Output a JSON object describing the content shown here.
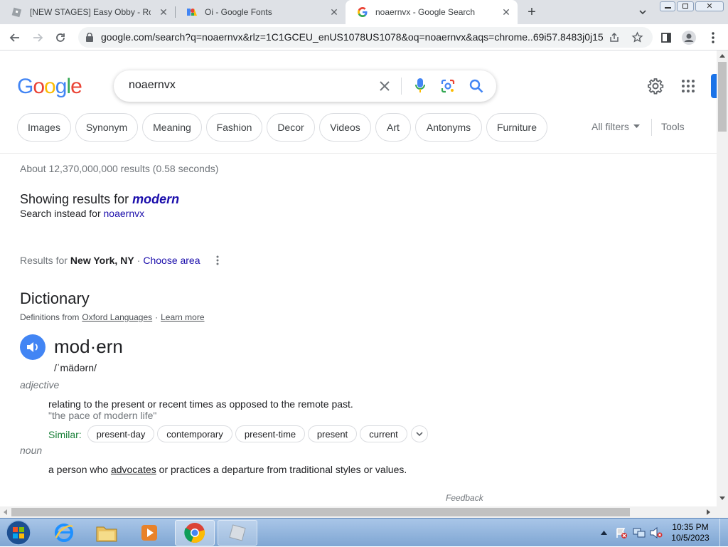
{
  "browser": {
    "tabs": [
      {
        "title": "[NEW STAGES] Easy Obby - Roblox",
        "close": "✕"
      },
      {
        "title": "Oi - Google Fonts",
        "close": "✕"
      },
      {
        "title": "noaernvx - Google Search",
        "close": "✕"
      }
    ],
    "new_tab": "+",
    "url": "google.com/search?q=noaernvx&rlz=1C1GCEU_enUS1078US1078&oq=noaernvx&aqs=chrome..69i57.8483j0j15..."
  },
  "search": {
    "logo": "Google",
    "query": "noaernvx",
    "chips": [
      "Images",
      "Synonym",
      "Meaning",
      "Fashion",
      "Decor",
      "Videos",
      "Art",
      "Antonyms",
      "Furniture"
    ],
    "all_filters": "All filters",
    "tools": "Tools",
    "result_stats": "About 12,370,000,000 results (0.58 seconds)",
    "showing_prefix": "Showing results for",
    "corrected": "modern",
    "instead_prefix": "Search instead for",
    "instead_query": "noaernvx",
    "location_prefix": "Results for",
    "location": "New York, NY",
    "location_sep": "·",
    "choose_area": "Choose area"
  },
  "dictionary": {
    "title": "Dictionary",
    "source_prefix": "Definitions from",
    "source": "Oxford Languages",
    "source_sep": "·",
    "learn_more": "Learn more",
    "word": "mod·ern",
    "phonetic": "/ˈmädərn/",
    "pos1": "adjective",
    "def1": "relating to the present or recent times as opposed to the remote past.",
    "example1": "\"the pace of modern life\"",
    "similar_label": "Similar:",
    "similar": [
      "present-day",
      "contemporary",
      "present-time",
      "present",
      "current"
    ],
    "pos2": "noun",
    "def2_before": "a person who",
    "def2_link": "advocates",
    "def2_after": "or practices a departure from traditional styles or values.",
    "feedback": "Feedback"
  },
  "taskbar": {
    "time": "10:35 PM",
    "date": "10/5/2023"
  },
  "colors": {
    "google_blue": "#4285f4",
    "google_red": "#ea4335",
    "google_yellow": "#fbbc05",
    "google_green": "#34a853",
    "link": "#1a0dab"
  }
}
